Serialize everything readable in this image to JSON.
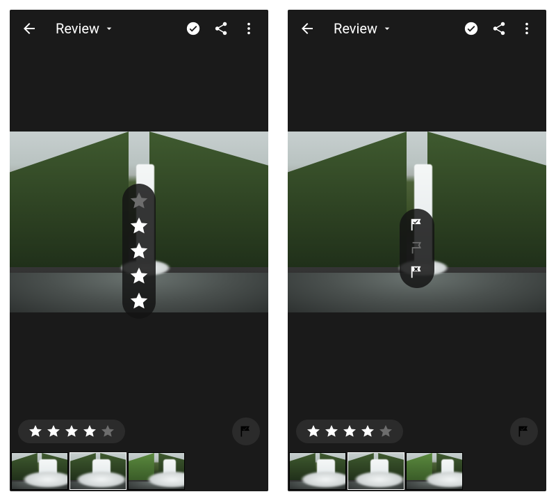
{
  "screens": {
    "left": {
      "overlay": "stars"
    },
    "right": {
      "overlay": "flags"
    }
  },
  "appbar": {
    "title": "Review",
    "icons": {
      "back": "back-arrow-icon",
      "select": "check-circle-icon",
      "share": "share-icon",
      "more": "more-vert-icon",
      "dropdown": "caret-down-icon"
    }
  },
  "rating": {
    "current_stars": 4,
    "max_stars": 5
  },
  "star_overlay": {
    "levels": [
      5,
      4,
      3,
      2,
      1
    ],
    "highlighted_from": 4
  },
  "flag_overlay": {
    "options": [
      {
        "id": "pick",
        "label": "Pick flag",
        "state": "on"
      },
      {
        "id": "unflagged",
        "label": "Unflagged",
        "state": "dim"
      },
      {
        "id": "reject",
        "label": "Reject flag",
        "state": "on"
      }
    ]
  },
  "flag_button": {
    "state": "pick"
  },
  "filmstrip": {
    "count": 3,
    "selected_index": 1
  }
}
